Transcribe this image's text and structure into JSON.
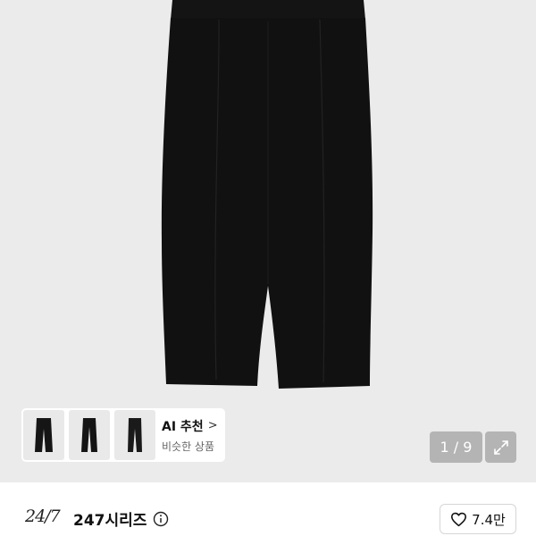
{
  "product_gallery": {
    "page_counter": "1 / 9",
    "image_description_icon": "pants-product-image"
  },
  "ai_recommend": {
    "title": "AI 추천",
    "chevron": ">",
    "subtitle": "비슷한 상품"
  },
  "store": {
    "logo_text": "24/7",
    "name": "247시리즈",
    "info_icon": "info-icon"
  },
  "like": {
    "icon": "heart-icon",
    "count": "7.4만"
  },
  "colors": {
    "image_bg": "#ebebeb",
    "pants": "#111111",
    "overlay": "#969696"
  }
}
